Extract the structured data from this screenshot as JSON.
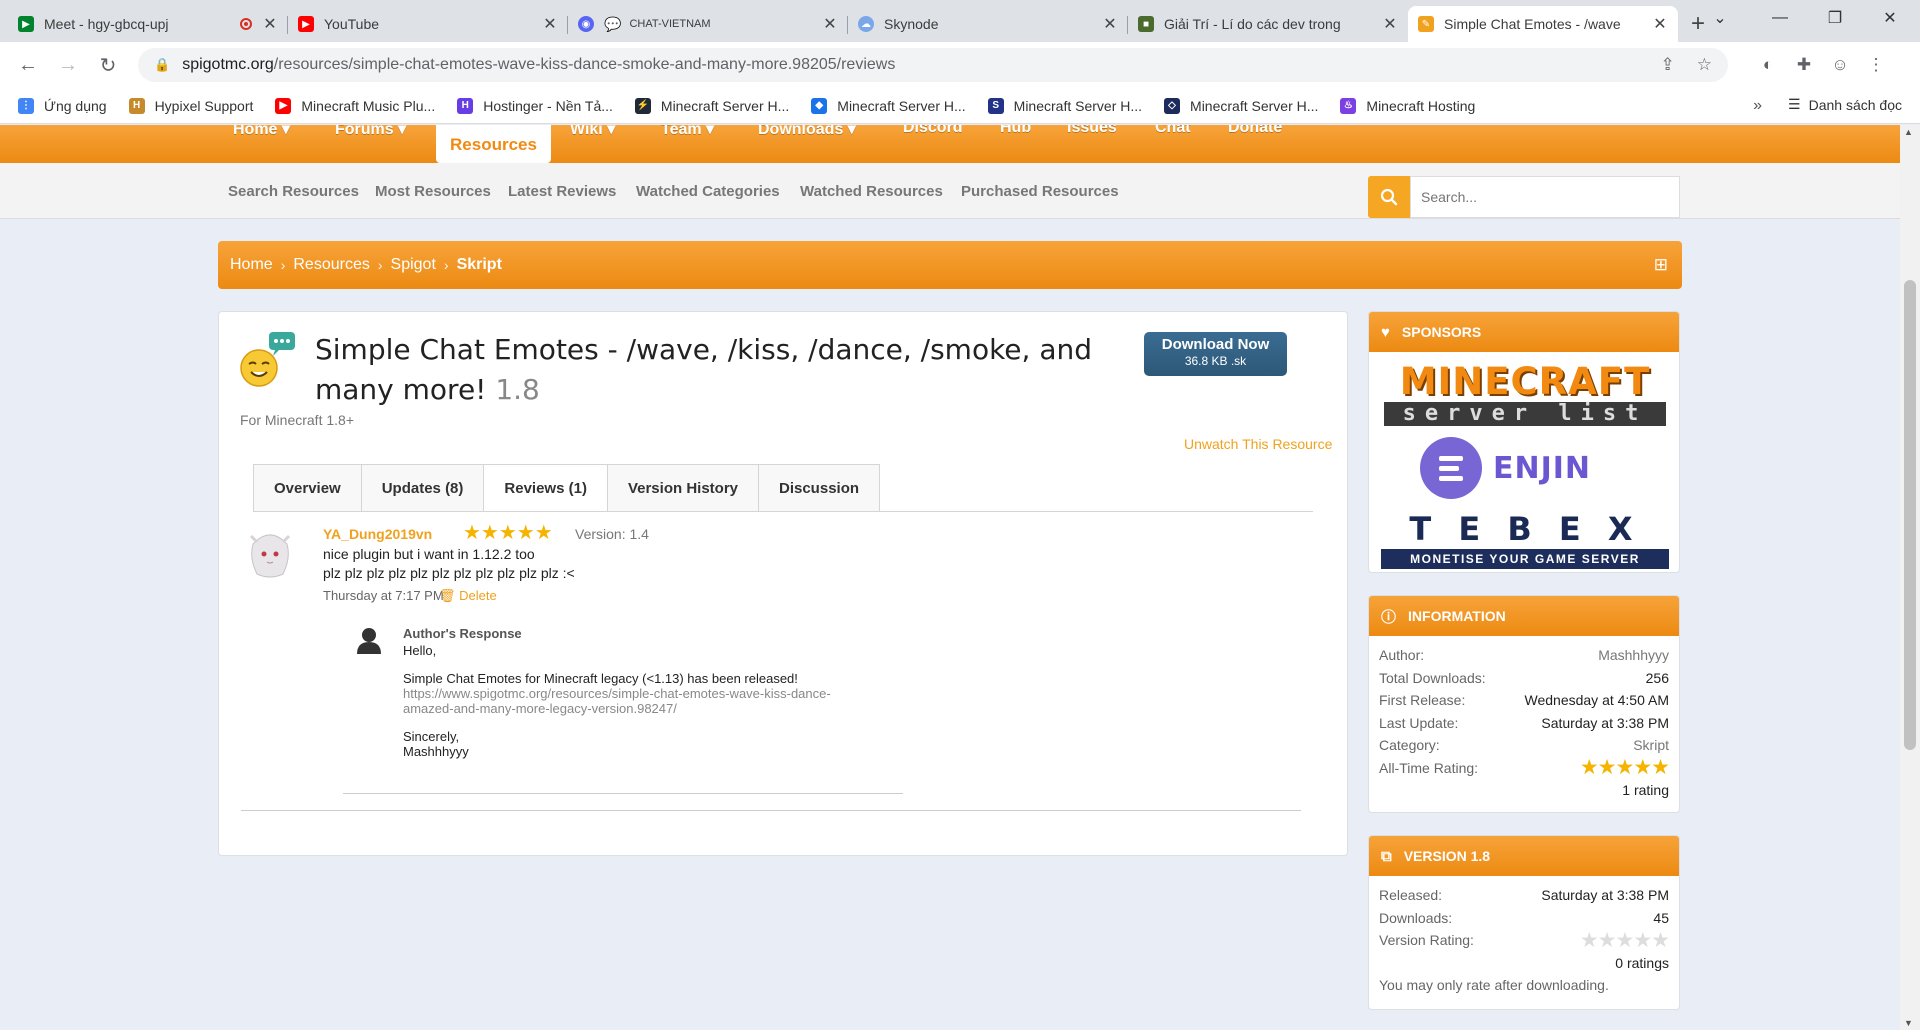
{
  "browser": {
    "tabs": [
      {
        "title": "Meet - hgy-gbcq-upj",
        "icon": "google-meet-icon",
        "recording": true
      },
      {
        "title": "YouTube",
        "icon": "youtube-icon"
      },
      {
        "title": "CHAT-VIETNAM",
        "icon": "discord-icon"
      },
      {
        "title": "Skynode",
        "icon": "skynode-icon"
      },
      {
        "title": "Giải Trí - Lí do các dev trong",
        "icon": "minecraft-icon"
      },
      {
        "title": "Simple Chat Emotes - /wave",
        "icon": "spigot-icon",
        "active": true
      }
    ],
    "url_host": "spigotmc.org",
    "url_path": "/resources/simple-chat-emotes-wave-kiss-dance-smoke-and-many-more.98205/reviews",
    "bookmarks": [
      {
        "label": "Ứng dụng",
        "icon": "apps-icon",
        "color": "#4285f4"
      },
      {
        "label": "Hypixel Support",
        "icon": "hypixel-icon",
        "color": "#c78a2b"
      },
      {
        "label": "Minecraft Music Plu...",
        "icon": "youtube-icon",
        "color": "#ff0000"
      },
      {
        "label": "Hostinger - Nền Tả...",
        "icon": "hostinger-icon",
        "color": "#673de6"
      },
      {
        "label": "Minecraft Server H...",
        "icon": "server-icon",
        "color": "#1e2a3a"
      },
      {
        "label": "Minecraft Server H...",
        "icon": "cube-icon",
        "color": "#1a73e8"
      },
      {
        "label": "Minecraft Server H...",
        "icon": "server-icon",
        "color": "#223388"
      },
      {
        "label": "Minecraft Server H...",
        "icon": "cube-icon",
        "color": "#1c2a5c"
      },
      {
        "label": "Minecraft Hosting",
        "icon": "flame-icon",
        "color": "#7b3fe4"
      }
    ],
    "bookmarks_more": "»",
    "reading_list": "Danh sách đọc"
  },
  "site_nav": {
    "items": [
      "Home ▾",
      "Forums ▾",
      "Wiki ▾",
      "Team ▾",
      "Downloads ▾",
      "Discord",
      "Hub",
      "Issues",
      "Chat",
      "Donate"
    ],
    "active": "Resources"
  },
  "sub_nav": {
    "links": [
      "Search Resources",
      "Most Resources",
      "Latest Reviews",
      "Watched Categories",
      "Watched Resources",
      "Purchased Resources"
    ],
    "search_placeholder": "Search..."
  },
  "breadcrumb": [
    "Home",
    "Resources",
    "Spigot",
    "Skript"
  ],
  "resource": {
    "title": "Simple Chat Emotes - /wave, /kiss, /dance, /smoke, and many more!",
    "version": "1.8",
    "subtitle": "For Minecraft 1.8+",
    "download_label": "Download Now",
    "download_meta": "36.8 KB .sk",
    "unwatch": "Unwatch This Resource",
    "tabs": [
      "Overview",
      "Updates (8)",
      "Reviews (1)",
      "Version History",
      "Discussion"
    ],
    "active_tab": "Reviews (1)"
  },
  "review": {
    "user": "YA_Dung2019vn",
    "rating": 5,
    "stars": "★★★★★",
    "version": "Version: 1.4",
    "line1": "nice plugin but i want in 1.12.2 too",
    "line2": "plz plz plz plz plz plz plz plz plz plz plz :<",
    "time": "Thursday at 7:17 PM",
    "delete": "Delete",
    "response": {
      "heading": "Author's Response",
      "greeting": "Hello,",
      "body": "Simple Chat Emotes for Minecraft legacy (<1.13) has been released!",
      "link1": "https://www.spigotmc.org/resources/simple-chat-emotes-wave-kiss-dance-",
      "link2": "amazed-and-many-more-legacy-version.98247/",
      "signoff": "Sincerely,",
      "name": "Mashhhyyy"
    }
  },
  "sponsors": {
    "title": "SPONSORS",
    "logo1a": "MINECRAFT",
    "logo1b": "server list",
    "logo2": "ENJIN",
    "logo3": "T E B E X",
    "logo3_tag": "MONETISE YOUR GAME SERVER"
  },
  "information": {
    "title": "INFORMATION",
    "rows": [
      {
        "k": "Author:",
        "v": "Mashhhyyy"
      },
      {
        "k": "Total Downloads:",
        "v": "256"
      },
      {
        "k": "First Release:",
        "v": "Wednesday at 4:50 AM"
      },
      {
        "k": "Last Update:",
        "v": "Saturday at 3:38 PM"
      },
      {
        "k": "Category:",
        "v": "Skript"
      }
    ],
    "rating_label": "All-Time Rating:",
    "rating_value": 5,
    "rating_stars": "★★★★★",
    "rating_count": "1 rating"
  },
  "version_box": {
    "title": "VERSION 1.8",
    "rows": [
      {
        "k": "Released:",
        "v": "Saturday at 3:38 PM"
      },
      {
        "k": "Downloads:",
        "v": "45"
      }
    ],
    "rating_label": "Version Rating:",
    "rating_value": 0,
    "rating_stars": "★★★★★",
    "rating_count": "0 ratings",
    "note": "You may only rate after downloading."
  },
  "colors": {
    "accent": "#f28a12",
    "link": "#f0a21e",
    "button": "#2d5877"
  }
}
